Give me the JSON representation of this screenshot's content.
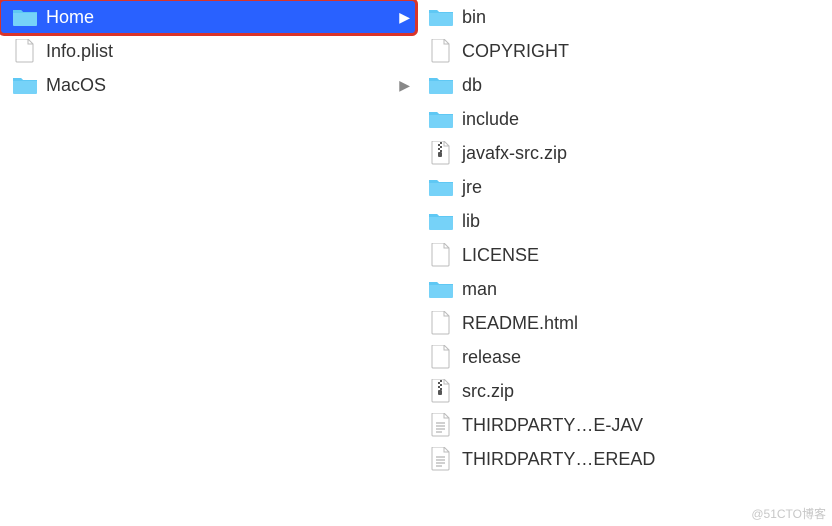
{
  "left_column": [
    {
      "label": "Home",
      "type": "folder",
      "selected": true,
      "highlighted": true,
      "has_children": true
    },
    {
      "label": "Info.plist",
      "type": "file",
      "selected": false,
      "has_children": false
    },
    {
      "label": "MacOS",
      "type": "folder",
      "selected": false,
      "has_children": true
    }
  ],
  "right_column": [
    {
      "label": "bin",
      "type": "folder"
    },
    {
      "label": "COPYRIGHT",
      "type": "file"
    },
    {
      "label": "db",
      "type": "folder"
    },
    {
      "label": "include",
      "type": "folder"
    },
    {
      "label": "javafx-src.zip",
      "type": "zip"
    },
    {
      "label": "jre",
      "type": "folder"
    },
    {
      "label": "lib",
      "type": "folder"
    },
    {
      "label": "LICENSE",
      "type": "file"
    },
    {
      "label": "man",
      "type": "folder"
    },
    {
      "label": "README.html",
      "type": "file"
    },
    {
      "label": "release",
      "type": "file"
    },
    {
      "label": "src.zip",
      "type": "zip"
    },
    {
      "label": "THIRDPARTY…E-JAV",
      "type": "textfile"
    },
    {
      "label": "THIRDPARTY…EREAD",
      "type": "textfile"
    }
  ],
  "watermark": "@51CTO博客"
}
